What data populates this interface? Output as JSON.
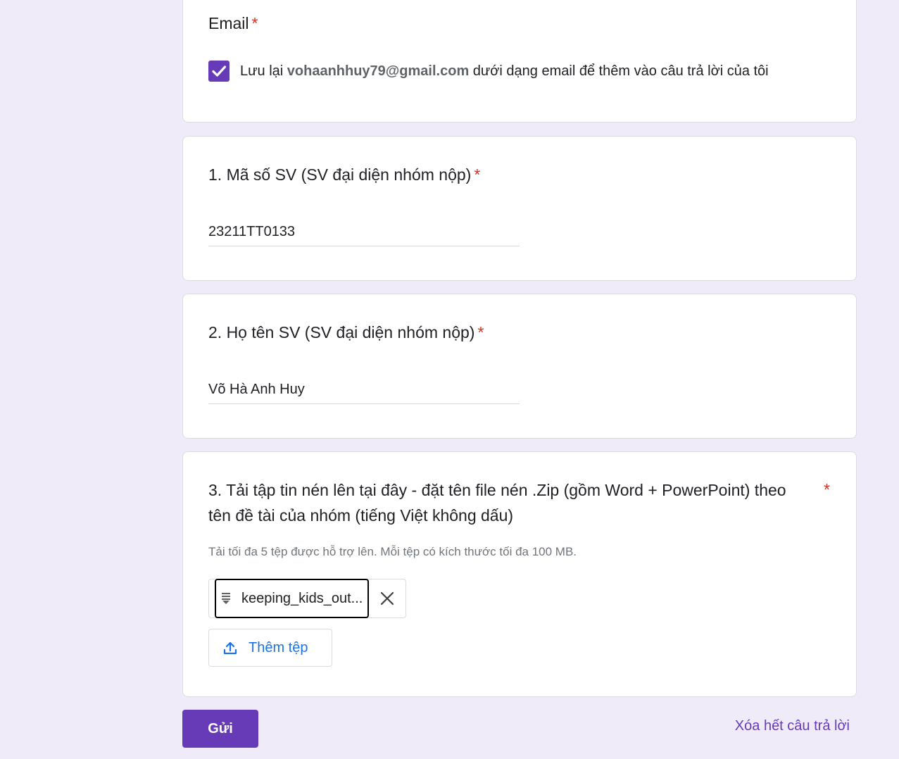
{
  "email_card": {
    "label": "Email",
    "required_mark": "*",
    "save_prefix": "Lưu lại ",
    "email": "vohaanhhuy79@gmail.com",
    "save_suffix": " dưới dạng email để thêm vào câu trả lời của tôi",
    "checked": true
  },
  "q1": {
    "title": "1. Mã số SV (SV đại diện nhóm nộp)",
    "required_mark": "*",
    "value": "23211TT0133"
  },
  "q2": {
    "title": "2. Họ tên SV (SV đại diện nhóm nộp)",
    "required_mark": "*",
    "value": "Võ Hà Anh Huy"
  },
  "q3": {
    "title_line1": "3. Tải tập tin nén lên tại đây - đặt tên file  nén .Zip (gồm Word + PowerPoint)  theo",
    "title_line2": "tên đề tài của nhóm (tiếng Việt không dấu)",
    "required_mark": "*",
    "hint": "Tải tối đa 5 tệp được hỗ trợ lên. Mỗi tệp có kích thước tối đa 100 MB.",
    "file_name": "keeping_kids_out...",
    "add_file_label": "Thêm tệp"
  },
  "footer": {
    "submit_label": "Gửi",
    "clear_label": "Xóa hết câu trả lời"
  },
  "colors": {
    "accent": "#673ab7",
    "link_blue": "#1a73e8",
    "required_red": "#d93025",
    "background": "#f0ebf8"
  }
}
